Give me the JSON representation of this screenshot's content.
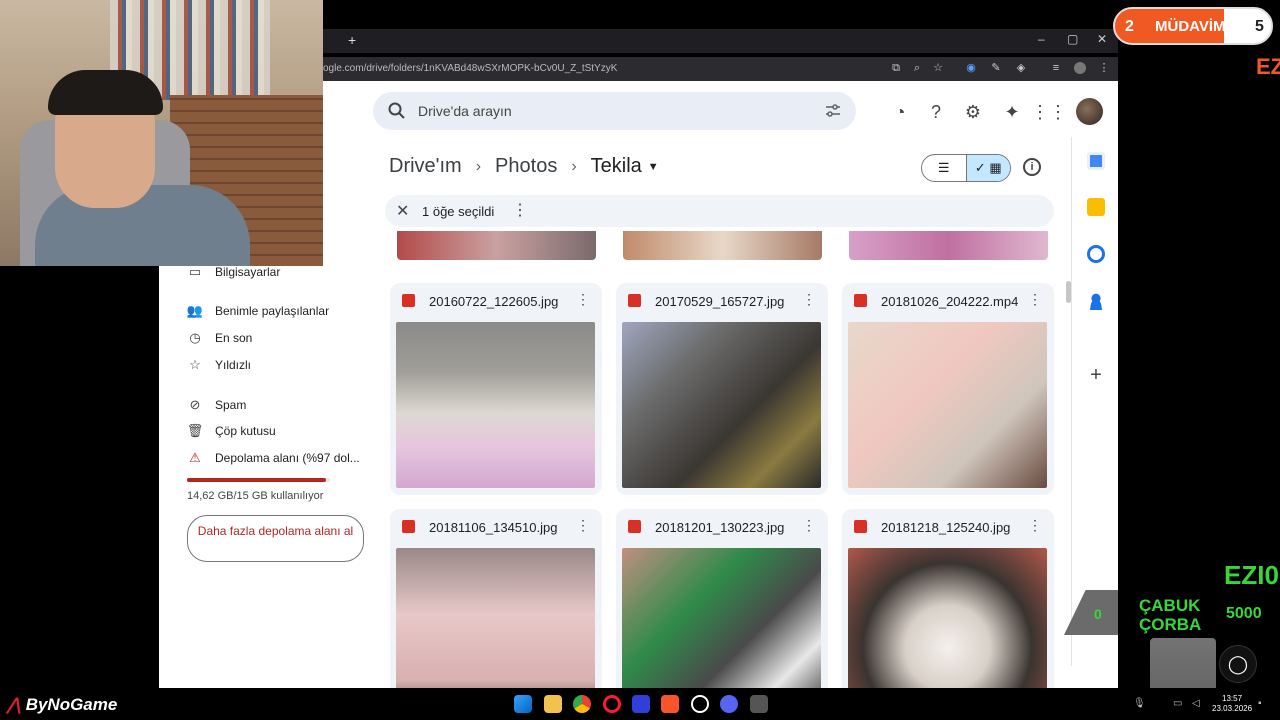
{
  "browser": {
    "url": "ogle.com/drive/folders/1nKVABd48wSXrMOPK-bCv0U_Z_tStYzyK",
    "new_tab": "+"
  },
  "drive": {
    "search_placeholder": "Drive'da arayın",
    "breadcrumb": [
      "Drive'ım",
      "Photos",
      "Tekila"
    ],
    "selection_text": "1 öğe seçildi",
    "files": [
      {
        "name": "20160722_122605.jpg",
        "type": "image"
      },
      {
        "name": "20170529_165727.jpg",
        "type": "image"
      },
      {
        "name": "20181026_204222.mp4",
        "type": "video"
      },
      {
        "name": "20181106_134510.jpg",
        "type": "image"
      },
      {
        "name": "20181201_130223.jpg",
        "type": "image"
      },
      {
        "name": "20181218_125240.jpg",
        "type": "image"
      }
    ]
  },
  "sidebar": {
    "items": [
      {
        "label": "Bilgisayarlar",
        "icon": "computer-icon"
      },
      {
        "label": "Benimle paylaşılanlar",
        "icon": "people-icon"
      },
      {
        "label": "En son",
        "icon": "clock-icon"
      },
      {
        "label": "Yıldızlı",
        "icon": "star-icon"
      },
      {
        "label": "Spam",
        "icon": "spam-icon"
      },
      {
        "label": "Çöp kutusu",
        "icon": "trash-icon"
      },
      {
        "label": "Depolama alanı (%97 dol...",
        "icon": "warning-icon"
      }
    ],
    "storage_used_fraction": 0.97,
    "storage_text": "14,62 GB/15 GB kullanılıyor",
    "more_storage_button": "Daha fazla depolama alanı al"
  },
  "overlay": {
    "mudavim_left": "2",
    "mudavim_label": "MÜDAVİM",
    "mudavim_right": "5",
    "ez_top": "EZ",
    "ez_bottom": "EZI0",
    "corba": "ÇABUK ÇORBA",
    "score": "5000",
    "zero": "0",
    "brand": "ByNoGame"
  },
  "taskbar": {
    "time": "13:57",
    "date": "23.03.2026"
  }
}
